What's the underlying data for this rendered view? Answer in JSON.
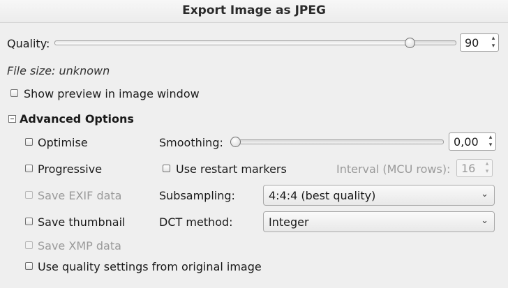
{
  "window": {
    "title": "Export Image as JPEG"
  },
  "quality": {
    "label": "Quality:",
    "value": "90",
    "level": 0.9
  },
  "file_size": "File size: unknown",
  "show_preview": {
    "label": "Show preview in image window",
    "checked": false
  },
  "advanced": {
    "header": "Advanced Options",
    "optimise": "Optimise",
    "progressive": "Progressive",
    "save_exif": "Save EXIF data",
    "save_thumbnail": "Save thumbnail",
    "save_xmp": "Save XMP data",
    "use_quality": "Use quality settings from original image",
    "smoothing": {
      "label": "Smoothing:",
      "value": "0,00",
      "level": 0
    },
    "restart_markers": "Use restart markers",
    "interval": {
      "label": "Interval (MCU rows):",
      "value": "16"
    },
    "subsampling": {
      "label": "Subsampling:",
      "value": "4:4:4 (best quality)"
    },
    "dct": {
      "label": "DCT method:",
      "value": "Integer"
    }
  },
  "icons": {
    "spin_up": "▴",
    "spin_down": "▾",
    "chevron": "⌄"
  }
}
